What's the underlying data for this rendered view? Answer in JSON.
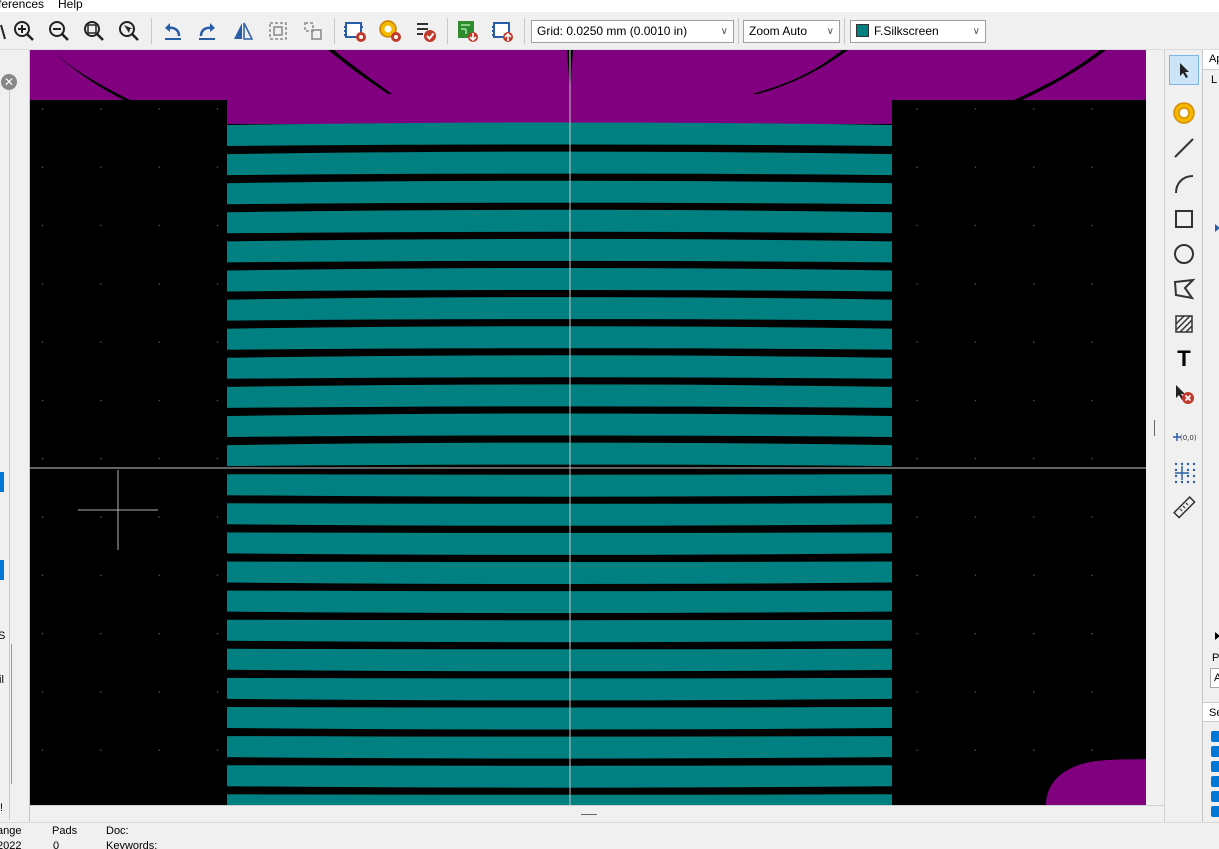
{
  "menu": {
    "preferences": "ferences",
    "help": "Help"
  },
  "toolbar": {
    "grid_label": "Grid: 0.0250 mm (0.0010 in)",
    "zoom_label": "Zoom Auto",
    "layer_label": "F.Silkscreen",
    "layer_color": "#008080",
    "icons": [
      "zoom-in-icon",
      "zoom-out-icon",
      "zoom-fit-icon",
      "zoom-selection-icon",
      "undo-icon",
      "redo-icon",
      "mirror-icon",
      "group-icon",
      "ungroup-icon",
      "footprint-properties-icon",
      "pad-properties-icon",
      "footprint-checker-icon",
      "load-from-board-icon",
      "insert-into-board-icon"
    ]
  },
  "right_tools": {
    "text_tool_glyph": "T",
    "coords_label": "(0,0)",
    "icons": [
      "select-icon",
      "pad-icon",
      "line-icon",
      "arc-icon",
      "rectangle-icon",
      "circle-icon",
      "polygon-icon",
      "zone-icon",
      "text-icon",
      "delete-icon",
      "anchor-icon",
      "grid-origin-icon",
      "ruler-icon"
    ]
  },
  "far_right": {
    "appearance_tab": "Ap",
    "layers_tab": "L",
    "presets_label": "P",
    "presets_value": "A",
    "selection_label": "Se"
  },
  "left_panel": {
    "label_s": "S",
    "label_il": "il",
    "label_excl": "!"
  },
  "status": {
    "col1_header": "ange",
    "col1_value": "2022",
    "pads_header": "Pads",
    "pads_value": "0",
    "doc_header": "Doc:",
    "keywords_header": "Keywords:"
  },
  "colors": {
    "canvas_bg": "#000000",
    "silkscreen": "#008080",
    "courtyard": "#800080",
    "accent": "#0078d7"
  }
}
